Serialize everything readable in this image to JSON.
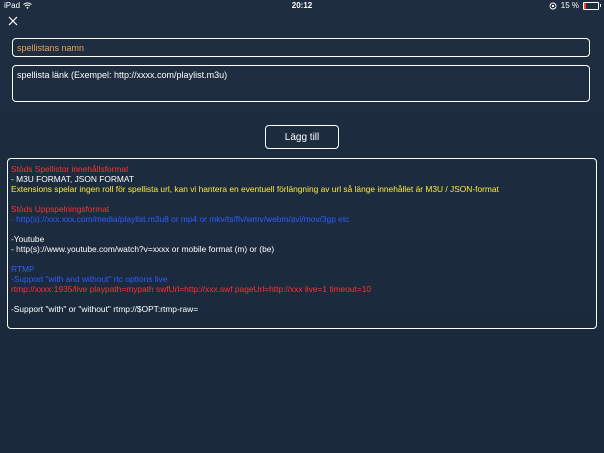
{
  "status_bar": {
    "device": "iPad",
    "time": "20:12",
    "battery": "15 %",
    "battery_level": 0.15
  },
  "close_button": {
    "icon": "close-icon"
  },
  "name_field": {
    "placeholder": "spellistans namn"
  },
  "link_field": {
    "placeholder": "spellista länk (Exempel: http://xxxx.com/playlist.m3u)"
  },
  "add_button": {
    "label": "Lägg till"
  },
  "info": {
    "lines": [
      {
        "text": "Stöds Spellistor innehållsformat",
        "color": "red"
      },
      {
        "text": "- M3U FORMAT, JSON FORMAT",
        "color": "white"
      },
      {
        "text": "Extensions spelar ingen roll för spellista url, kan vi hantera en eventuell förlängning av url så länge innehållet är M3U / JSON-format",
        "color": "yellow"
      },
      {
        "text": "",
        "color": "white"
      },
      {
        "text": "Stöds Uppspelningsformat",
        "color": "red"
      },
      {
        "text": "- http(s)://xxx.xxx.com/media/playlist.m3u8 or mp4 or mkv/ts/flv/wmv/webm/avi/mov/3gp etc",
        "color": "blue"
      },
      {
        "text": "",
        "color": "white"
      },
      {
        "text": "-Youtube",
        "color": "white"
      },
      {
        "text": "- http(s)://www.youtube.com/watch?v=xxxx or mobile format (m) or (be)",
        "color": "white"
      },
      {
        "text": "",
        "color": "white"
      },
      {
        "text": "RTMP",
        "color": "blue"
      },
      {
        "text": "-Support \"with and without\" rtc options live",
        "color": "blue"
      },
      {
        "text": "rtmp://xxxx:1935/live playpath=mypath swfUrl=http://xxx.swf pageUrl=http://xxx live=1 timeout=10",
        "color": "red"
      },
      {
        "text": "",
        "color": "white"
      },
      {
        "text": "-Support \"with\" or \"without\" rtmp://$OPT:rtmp-raw=",
        "color": "white"
      }
    ]
  }
}
